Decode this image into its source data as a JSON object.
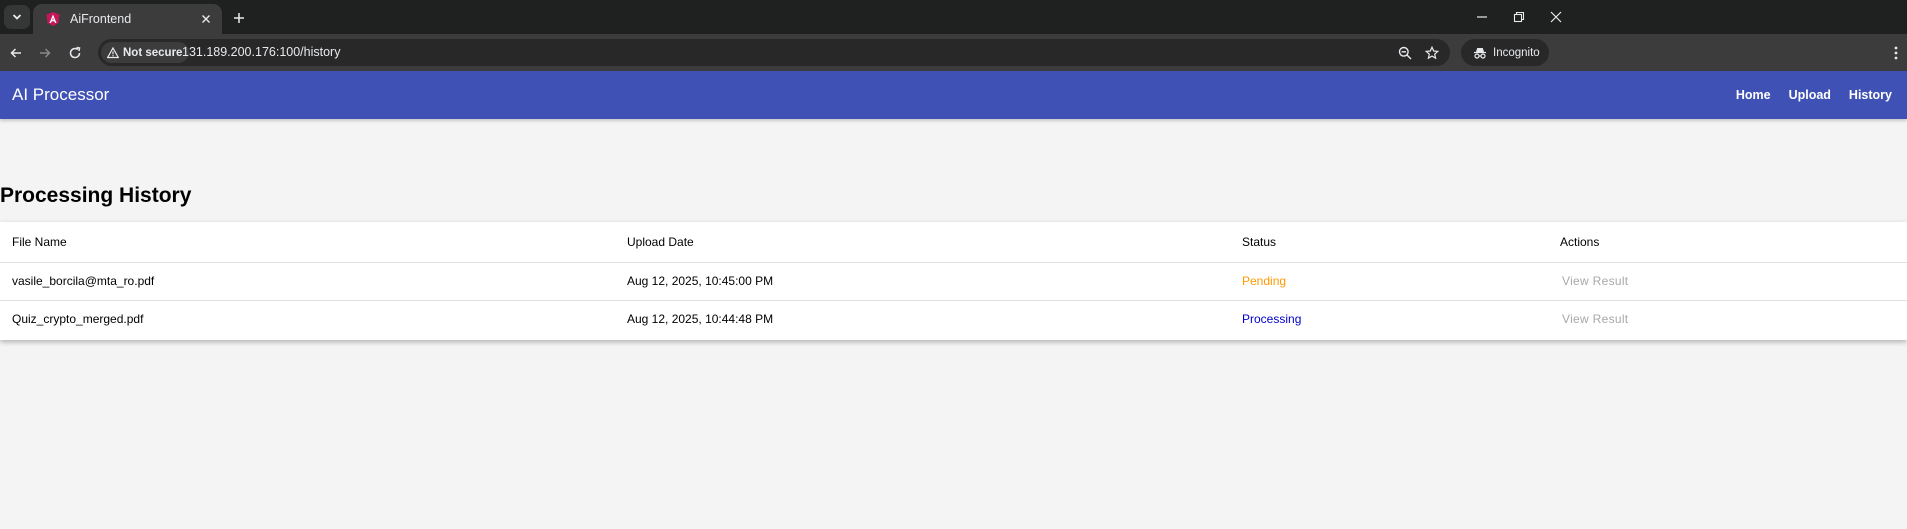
{
  "browser": {
    "tab_title": "AiFrontend",
    "security_label": "Not secure",
    "url": "131.189.200.176:100/history",
    "incognito_label": "Incognito"
  },
  "app": {
    "title": "AI Processor",
    "nav": [
      "Home",
      "Upload",
      "History"
    ],
    "colors": {
      "toolbar": "#3f51b5",
      "pending": "#ff9800",
      "processing": "#0000cc"
    }
  },
  "history": {
    "heading": "Processing History",
    "columns": [
      "File Name",
      "Upload Date",
      "Status",
      "Actions"
    ],
    "rows": [
      {
        "file": "vasile_borcila@mta_ro.pdf",
        "date": "Aug 12, 2025, 10:45:00 PM",
        "status": "Pending",
        "action": "View Result"
      },
      {
        "file": "Quiz_crypto_merged.pdf",
        "date": "Aug 12, 2025, 10:44:48 PM",
        "status": "Processing",
        "action": "View Result"
      }
    ]
  }
}
